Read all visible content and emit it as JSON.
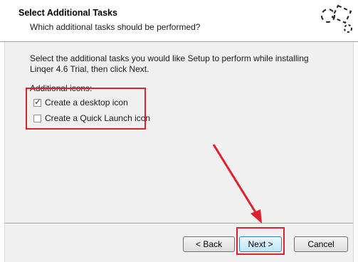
{
  "header": {
    "title": "Select Additional Tasks",
    "subtitle": "Which additional tasks should be performed?"
  },
  "body": {
    "intro": "Select the additional tasks you would like Setup to perform while installing Linqer 4.6 Trial, then click Next.",
    "group_label": "Additional icons:",
    "tasks": [
      {
        "label": "Create a desktop icon",
        "checked": true
      },
      {
        "label": "Create a Quick Launch icon",
        "checked": false
      }
    ]
  },
  "buttons": {
    "back": "< Back",
    "next": "Next >",
    "cancel": "Cancel"
  },
  "colors": {
    "annotation": "#e0202a",
    "header_bg": "#ffffff",
    "dialog_bg": "#f0f0f0"
  },
  "icons": [
    "wizard-logo-icon",
    "checkmark-icon",
    "annotation-arrow"
  ]
}
